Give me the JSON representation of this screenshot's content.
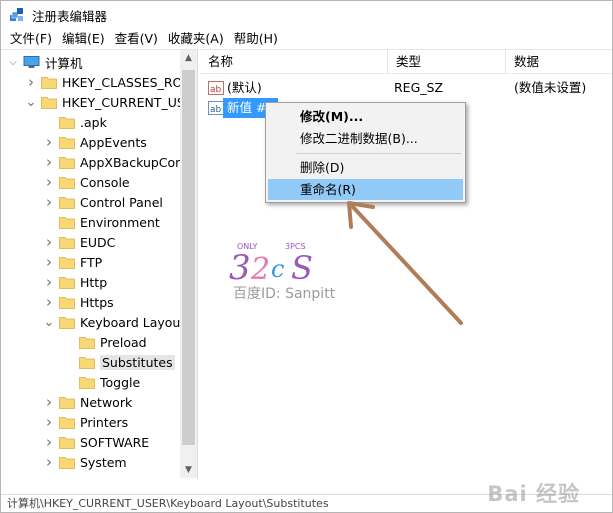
{
  "window": {
    "title": "注册表编辑器",
    "app_icon": "registry-editor-icon"
  },
  "menubar": {
    "items": [
      "文件(F)",
      "编辑(E)",
      "查看(V)",
      "收藏夹(A)",
      "帮助(H)"
    ]
  },
  "tree": {
    "root": "计算机",
    "items": [
      {
        "label": "HKEY_CLASSES_ROOT",
        "state": "collapsed",
        "level": 1
      },
      {
        "label": "HKEY_CURRENT_USER",
        "state": "expanded",
        "level": 1
      },
      {
        "label": ".apk",
        "state": "none",
        "level": 2
      },
      {
        "label": "AppEvents",
        "state": "collapsed",
        "level": 2
      },
      {
        "label": "AppXBackupContentType",
        "state": "collapsed",
        "level": 2
      },
      {
        "label": "Console",
        "state": "collapsed",
        "level": 2
      },
      {
        "label": "Control Panel",
        "state": "collapsed",
        "level": 2
      },
      {
        "label": "Environment",
        "state": "none",
        "level": 2
      },
      {
        "label": "EUDC",
        "state": "collapsed",
        "level": 2
      },
      {
        "label": "FTP",
        "state": "collapsed",
        "level": 2
      },
      {
        "label": "Http",
        "state": "collapsed",
        "level": 2
      },
      {
        "label": "Https",
        "state": "collapsed",
        "level": 2
      },
      {
        "label": "Keyboard Layout",
        "state": "expanded",
        "level": 2
      },
      {
        "label": "Preload",
        "state": "none",
        "level": 3
      },
      {
        "label": "Substitutes",
        "state": "none",
        "level": 3,
        "selected": true
      },
      {
        "label": "Toggle",
        "state": "none",
        "level": 3
      },
      {
        "label": "Network",
        "state": "collapsed",
        "level": 2
      },
      {
        "label": "Printers",
        "state": "collapsed",
        "level": 2
      },
      {
        "label": "SOFTWARE",
        "state": "collapsed",
        "level": 2
      },
      {
        "label": "System",
        "state": "collapsed",
        "level": 2
      }
    ]
  },
  "list": {
    "columns": {
      "name": "名称",
      "type": "类型",
      "data": "数据"
    },
    "rows": [
      {
        "name": "(默认)",
        "type": "REG_SZ",
        "data": "(数值未设置)"
      },
      {
        "name": "新值 #1",
        "type": "",
        "data": ""
      }
    ]
  },
  "context_menu": {
    "items": [
      "修改(M)...",
      "修改二进制数据(B)...",
      "删除(D)",
      "重命名(R)"
    ],
    "highlighted": "重命名(R)"
  },
  "watermark": {
    "text": "百度ID: Sanpitt",
    "baidu": "Bai 经验"
  },
  "statusbar": {
    "path": "计算机\\HKEY_CURRENT_USER\\Keyboard Layout\\Substitutes"
  },
  "colors": {
    "selection": "#3399ff",
    "menu_highlight": "#91c9f7",
    "folder": "#f8d775",
    "arrow": "#b07d5a"
  }
}
